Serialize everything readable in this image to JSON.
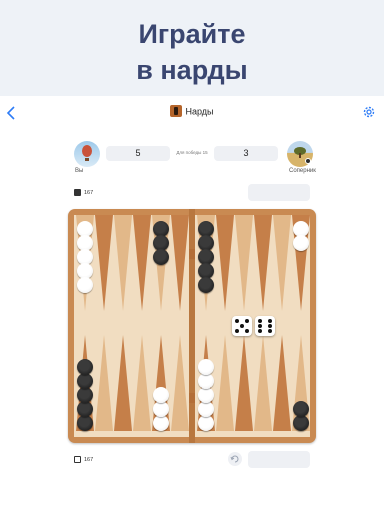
{
  "promo": {
    "line1": "Играйте",
    "line2": "в нарды"
  },
  "nav": {
    "back_icon": "chevron-left-icon",
    "title": "Нарды",
    "settings_icon": "gear-icon",
    "accent": "#2e7cf6"
  },
  "players": {
    "you": {
      "name": "Вы",
      "score": "5"
    },
    "opponent": {
      "name": "Соперник",
      "score": "3"
    },
    "win_to": "Для победы 15"
  },
  "timers": {
    "top": "167",
    "bottom": "167"
  },
  "board": {
    "frame_color": "#c98a52",
    "felt_color": "#f1ddc1",
    "dice": [
      5,
      6
    ],
    "left_top_points": [
      {
        "color": "white",
        "count": 5
      },
      null,
      null,
      null,
      {
        "color": "black",
        "count": 3
      },
      null
    ],
    "left_bottom_points": [
      {
        "color": "black",
        "count": 5
      },
      null,
      null,
      null,
      {
        "color": "white",
        "count": 3
      },
      null
    ],
    "right_top_points": [
      {
        "color": "black",
        "count": 5
      },
      null,
      null,
      null,
      null,
      {
        "color": "white",
        "count": 2
      }
    ],
    "right_bottom_points": [
      {
        "color": "white",
        "count": 5
      },
      null,
      null,
      null,
      null,
      {
        "color": "black",
        "count": 2
      }
    ]
  }
}
